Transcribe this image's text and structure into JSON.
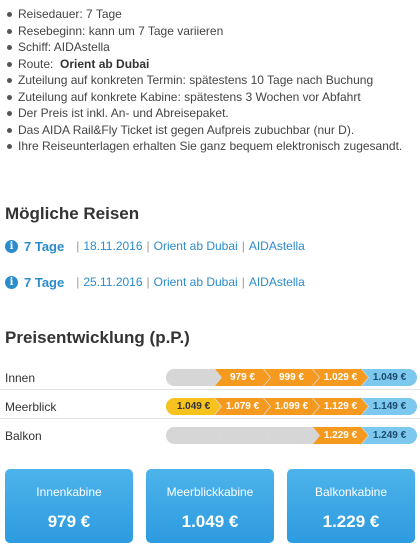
{
  "details": [
    {
      "text": "Reisedauer: 7 Tage"
    },
    {
      "text": "Resebeginn: kann um 7 Tage variieren"
    },
    {
      "text": "Schiff: AIDAstella"
    },
    {
      "prefix": "Route:  ",
      "bold": "Orient ab Dubai"
    },
    {
      "text": "Zuteilung auf konkreten Termin: spätestens 10 Tage nach Buchung"
    },
    {
      "text": "Zuteilung auf konkrete Kabine: spätestens 3 Wochen vor Abfahrt"
    },
    {
      "text": "Der Preis ist inkl. An- und Abreisepaket."
    },
    {
      "text": "Das AIDA Rail&Fly Ticket ist gegen Aufpreis zubuchbar (nur D)."
    },
    {
      "text": "Ihre Reiseunterlagen erhalten Sie ganz bequem elektronisch zugesandt."
    }
  ],
  "trips_heading": "Mögliche Reisen",
  "trips": [
    {
      "info_icon": "i",
      "days": "7 Tage",
      "sep1": "|",
      "date": "18.11.2016",
      "sep2": "|",
      "route": "Orient ab Dubai",
      "sep3": "|",
      "ship": "AIDAstella"
    },
    {
      "info_icon": "i",
      "days": "7 Tage",
      "sep1": "|",
      "date": "25.11.2016",
      "sep2": "|",
      "route": "Orient ab Dubai",
      "sep3": "|",
      "ship": "AIDAstella"
    }
  ],
  "price_heading": "Preisentwicklung (p.P.)",
  "price_rows": [
    {
      "label": "Innen",
      "segments": [
        {
          "value": "",
          "color": "grey"
        },
        {
          "value": "979 €",
          "color": "orange"
        },
        {
          "value": "999 €",
          "color": "orange"
        },
        {
          "value": "1.029 €",
          "color": "orange"
        },
        {
          "value": "1.049 €",
          "color": "blue"
        }
      ]
    },
    {
      "label": "Meerblick",
      "segments": [
        {
          "value": "1.049 €",
          "color": "yellow"
        },
        {
          "value": "1.079 €",
          "color": "orange"
        },
        {
          "value": "1.099 €",
          "color": "orange"
        },
        {
          "value": "1.129 €",
          "color": "orange"
        },
        {
          "value": "1.149 €",
          "color": "blue"
        }
      ]
    },
    {
      "label": "Balkon",
      "segments": [
        {
          "value": "",
          "color": "grey"
        },
        {
          "value": "",
          "color": "grey"
        },
        {
          "value": "",
          "color": "grey"
        },
        {
          "value": "1.229 €",
          "color": "orange"
        },
        {
          "value": "1.249 €",
          "color": "blue"
        }
      ]
    }
  ],
  "colors": {
    "grey": "#d6d6d6",
    "orange": "#f59a1f",
    "yellow": "#f8c21e",
    "blue": "#7dc8ee",
    "link": "#2b8ccc",
    "button": "#2d9be0"
  },
  "cabins": [
    {
      "label": "Innenkabine",
      "price": "979 €"
    },
    {
      "label": "Meerblickkabine",
      "price": "1.049 €"
    },
    {
      "label": "Balkonkabine",
      "price": "1.229 €"
    }
  ]
}
